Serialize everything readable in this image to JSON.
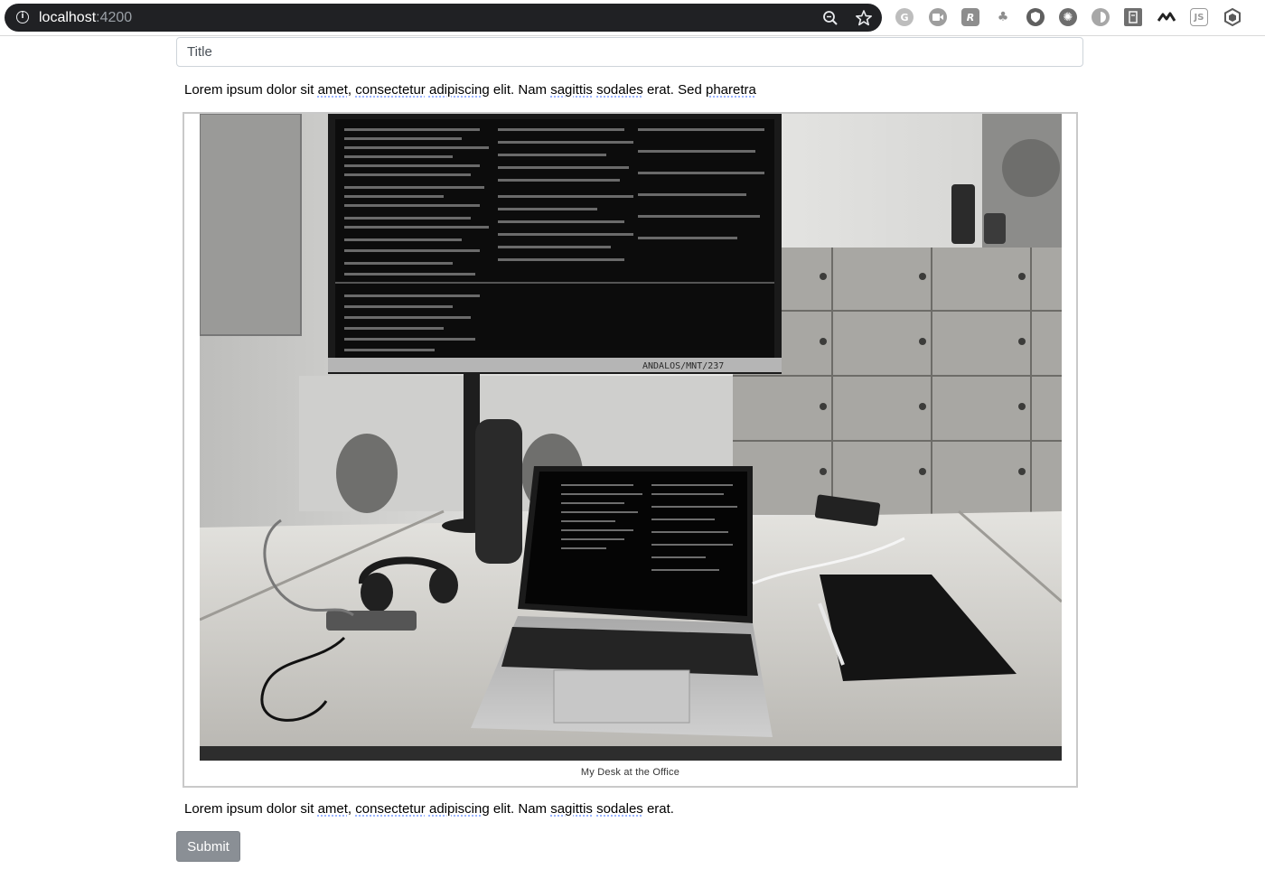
{
  "browser": {
    "url_host": "localhost",
    "url_port": ":4200",
    "extensions": [
      "grammarly-icon",
      "screen-recorder-icon",
      "r-extension-icon",
      "tree-icon",
      "shield-icon",
      "dribbble-icon",
      "half-circle-icon",
      "book-icon",
      "wave-logo-icon",
      "js-icon",
      "hexagon-icon"
    ]
  },
  "form": {
    "title_placeholder": "Title",
    "paragraph_1": [
      {
        "text": "Lorem ipsum dolor sit "
      },
      {
        "text": "amet",
        "spell": true
      },
      {
        "text": ", "
      },
      {
        "text": "consectetur",
        "spell": true
      },
      {
        "text": " "
      },
      {
        "text": "adipiscing",
        "spell": true
      },
      {
        "text": " elit. Nam "
      },
      {
        "text": "sagittis",
        "spell": true
      },
      {
        "text": " "
      },
      {
        "text": "sodales",
        "spell": true
      },
      {
        "text": " erat. Sed "
      },
      {
        "text": "pharetra",
        "spell": true
      }
    ],
    "figure_caption": "My Desk at the Office",
    "paragraph_2": [
      {
        "text": "Lorem ipsum dolor sit "
      },
      {
        "text": "amet",
        "spell": true
      },
      {
        "text": ", "
      },
      {
        "text": "consectetur",
        "spell": true
      },
      {
        "text": " "
      },
      {
        "text": "adipiscing",
        "spell": true
      },
      {
        "text": " elit. Nam "
      },
      {
        "text": "sagittis",
        "spell": true
      },
      {
        "text": " "
      },
      {
        "text": "sodales",
        "spell": true
      },
      {
        "text": " erat."
      }
    ],
    "submit_label": "Submit"
  },
  "photo_texts": {
    "monitor_label": "ANDALOS/MNT/237"
  },
  "colors": {
    "omnibox": "#202124",
    "button": "#8a8f95",
    "spellcheck_underline": "#7a9cff"
  }
}
